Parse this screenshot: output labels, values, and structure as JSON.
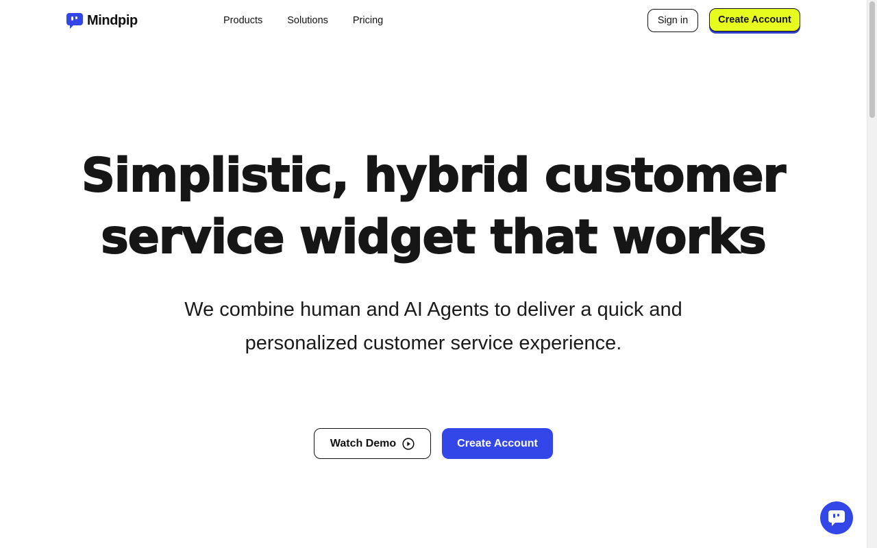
{
  "brand": {
    "name": "Mindpip",
    "accent_color": "#3347e8",
    "highlight_color": "#e8fb1f",
    "logo_icon": "speech-bubble-logo-icon"
  },
  "nav": {
    "items": [
      {
        "label": "Products"
      },
      {
        "label": "Solutions"
      },
      {
        "label": "Pricing"
      }
    ],
    "signin_label": "Sign in",
    "create_account_label": "Create Account"
  },
  "hero": {
    "title_line1": "Simplistic, hybrid customer",
    "title_line2": "service widget that works",
    "subtitle_line1": "We combine human and AI Agents to deliver a quick and",
    "subtitle_line2": "personalized customer service experience.",
    "watch_demo_label": "Watch Demo",
    "watch_demo_icon": "play-circle-icon",
    "create_account_label": "Create Account"
  },
  "chat_widget": {
    "icon": "chat-bubble-icon"
  }
}
